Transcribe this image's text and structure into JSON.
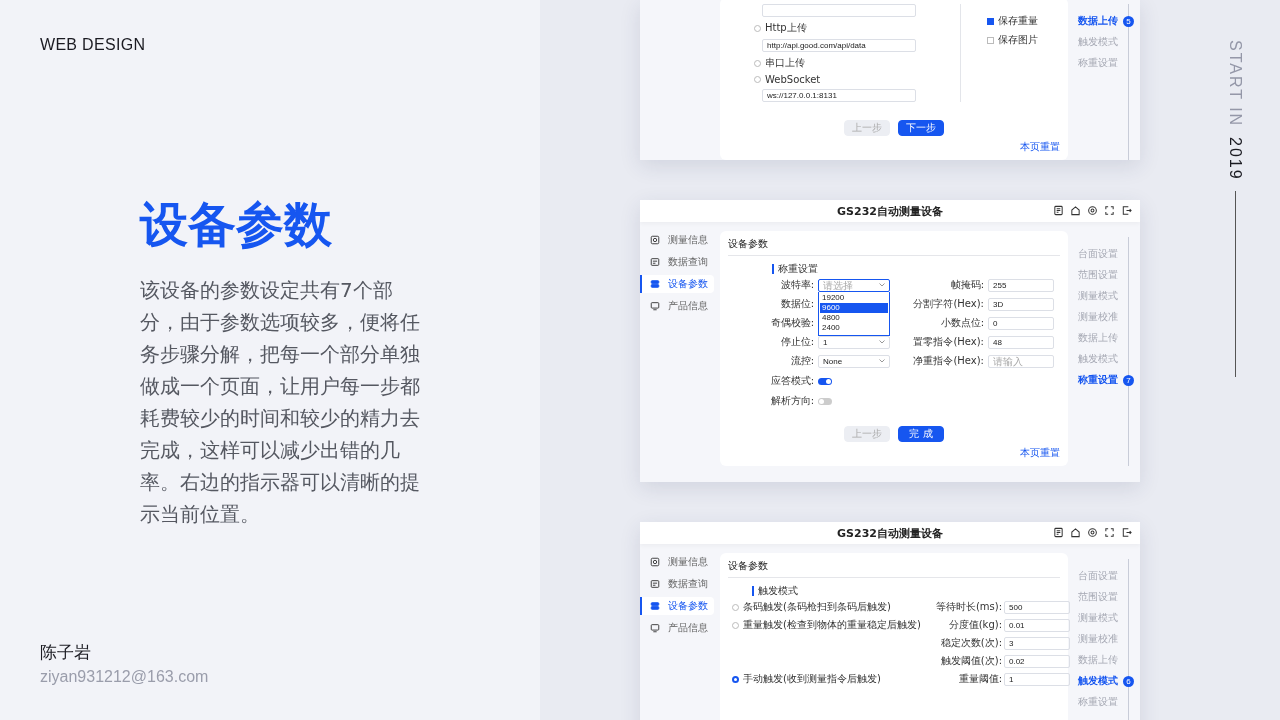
{
  "header": "WEB DESIGN",
  "title": "设备参数",
  "description": "该设备的参数设定共有7个部分，由于参数选项较多，便将任务步骤分解，把每一个部分单独做成一个页面，让用户每一步都耗费较少的时间和较少的精力去完成，这样可以减少出错的几率。右边的指示器可以清晰的提示当前位置。",
  "author": {
    "name": "陈子岩",
    "email": "ziyan931212@163.com"
  },
  "caption": {
    "lead": "START IN",
    "year": "2019"
  },
  "screens": [
    {
      "kind": "upload",
      "upload_options": [
        {
          "label": "Http上传",
          "selected": false,
          "value": "http://api.good.com/api/data"
        },
        {
          "label": "串口上传",
          "selected": false
        },
        {
          "label": "WebSocket",
          "selected": false,
          "value": "ws://127.0.0.1:8131"
        }
      ],
      "save_options": [
        {
          "label": "保存重量",
          "checked": true
        },
        {
          "label": "保存图片",
          "checked": false
        }
      ],
      "buttons": [
        {
          "label": "上一步",
          "disabled": true
        },
        {
          "label": "下一步",
          "disabled": false
        }
      ],
      "reset": "本页重置",
      "steps": [
        {
          "label": "数据上传",
          "selected": true,
          "marker": "5"
        },
        {
          "label": "触发模式",
          "selected": false
        },
        {
          "label": "称重设置",
          "selected": false
        }
      ]
    },
    {
      "kind": "weighing",
      "app_title": "GS232自动测量设备",
      "nav": [
        {
          "label": "测量信息",
          "selected": false
        },
        {
          "label": "数据查询",
          "selected": false
        },
        {
          "label": "设备参数",
          "selected": true
        },
        {
          "label": "产品信息",
          "selected": false
        }
      ],
      "card_title": "设备参数",
      "section": "称重设置",
      "rows": [
        {
          "left": {
            "kind": "dropdown",
            "label": "波特率:",
            "placeholder": "请选择",
            "options": [
              {
                "label": "19200",
                "selected": false
              },
              {
                "label": "9600",
                "selected": true
              },
              {
                "label": "4800",
                "selected": false
              },
              {
                "label": "2400",
                "selected": false
              }
            ]
          },
          "right": {
            "label": "帧掩码:",
            "value": "255"
          }
        },
        {
          "left": {
            "kind": "label",
            "label": "数据位:"
          },
          "right": {
            "label": "分割字符(Hex):",
            "value": "3D"
          }
        },
        {
          "left": {
            "kind": "label",
            "label": "奇偶校验:"
          },
          "right": {
            "label": "小数点位:",
            "value": "0"
          }
        },
        {
          "left": {
            "kind": "select",
            "label": "停止位:",
            "value": "1"
          },
          "right": {
            "label": "置零指令(Hex):",
            "value": "48"
          }
        },
        {
          "left": {
            "kind": "select",
            "label": "流控:",
            "value": "None"
          },
          "right": {
            "label": "净重指令(Hex):",
            "placeholder": "请输入"
          }
        }
      ],
      "toggles": [
        {
          "label": "应答模式:",
          "on": true
        },
        {
          "label": "解析方向:",
          "on": false
        }
      ],
      "buttons": [
        {
          "label": "上一步",
          "disabled": true
        },
        {
          "label": "完 成",
          "disabled": false
        }
      ],
      "reset": "本页重置",
      "steps": [
        {
          "label": "台面设置",
          "selected": false
        },
        {
          "label": "范围设置",
          "selected": false
        },
        {
          "label": "测量模式",
          "selected": false
        },
        {
          "label": "测量校准",
          "selected": false
        },
        {
          "label": "数据上传",
          "selected": false
        },
        {
          "label": "触发模式",
          "selected": false
        },
        {
          "label": "称重设置",
          "selected": true,
          "marker": "7"
        }
      ]
    },
    {
      "kind": "trigger",
      "app_title": "GS232自动测量设备",
      "nav": [
        {
          "label": "测量信息",
          "selected": false
        },
        {
          "label": "数据查询",
          "selected": false
        },
        {
          "label": "设备参数",
          "selected": true
        },
        {
          "label": "产品信息",
          "selected": false
        }
      ],
      "card_title": "设备参数",
      "section": "触发模式",
      "rows": [
        {
          "option": {
            "label": "条码触发(条码枪扫到条码后触发)",
            "selected": false
          },
          "field": {
            "label": "等待时长(ms):",
            "value": "500"
          }
        },
        {
          "option": {
            "label": "重量触发(检查到物体的重量稳定后触发)",
            "selected": false
          },
          "field": {
            "label": "分度值(kg):",
            "value": "0.01"
          }
        },
        {
          "field": {
            "label": "稳定次数(次):",
            "value": "3"
          }
        },
        {
          "field": {
            "label": "触发阈值(次):",
            "value": "0.02"
          }
        },
        {
          "option": {
            "label": "手动触发(收到测量指令后触发)",
            "selected": true
          },
          "field": {
            "label": "重量阈值:",
            "value": "1"
          }
        }
      ],
      "steps": [
        {
          "label": "台面设置",
          "selected": false
        },
        {
          "label": "范围设置",
          "selected": false
        },
        {
          "label": "测量模式",
          "selected": false
        },
        {
          "label": "测量校准",
          "selected": false
        },
        {
          "label": "数据上传",
          "selected": false
        },
        {
          "label": "触发模式",
          "selected": true,
          "marker": "6"
        },
        {
          "label": "称重设置",
          "selected": false
        }
      ]
    }
  ]
}
